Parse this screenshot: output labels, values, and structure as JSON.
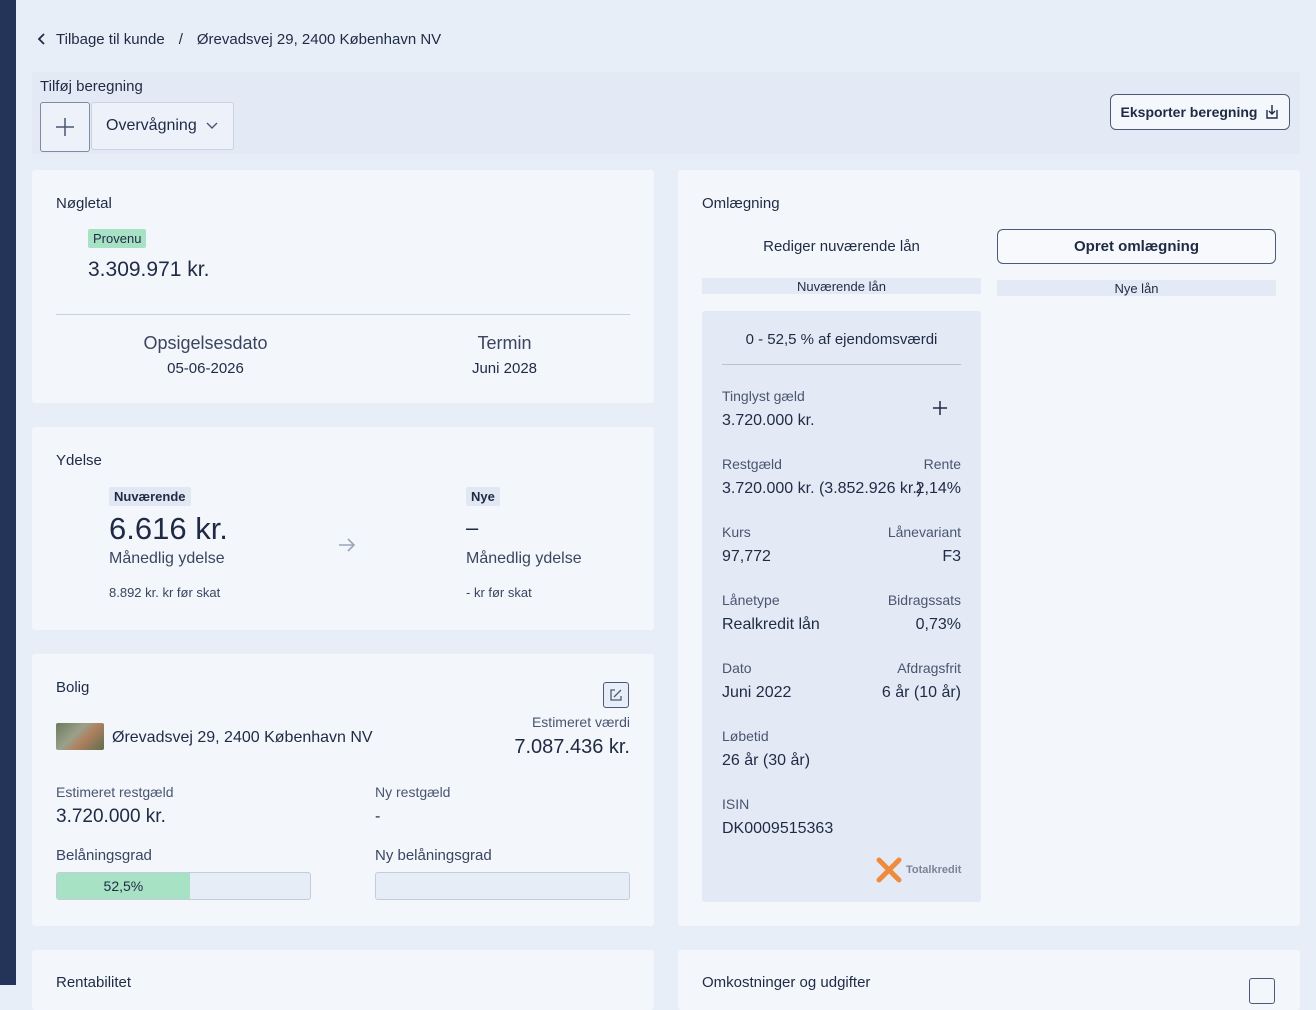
{
  "breadcrumb": {
    "back": "Tilbage til kunde",
    "separator": "/",
    "current": "Ørevadsvej 29, 2400 København NV"
  },
  "toolbar": {
    "add_label": "Tilføj beregning",
    "select_value": "Overvågning",
    "export_label": "Eksporter beregning"
  },
  "noegletal": {
    "title": "Nøgletal",
    "badge": "Provenu",
    "amount": "3.309.971 kr.",
    "opsigelse_label": "Opsigelsesdato",
    "opsigelse_value": "05-06-2026",
    "termin_label": "Termin",
    "termin_value": "Juni 2028"
  },
  "ydelse": {
    "title": "Ydelse",
    "current_badge": "Nuværende",
    "current_value": "6.616 kr.",
    "current_sub": "Månedlig ydelse",
    "current_tax": "8.892 kr. kr før skat",
    "new_badge": "Nye",
    "new_value": "–",
    "new_sub": "Månedlig ydelse",
    "new_tax": "- kr før skat"
  },
  "bolig": {
    "title": "Bolig",
    "address": "Ørevadsvej 29, 2400 København NV",
    "est_value_label": "Estimeret værdi",
    "est_value": "7.087.436 kr.",
    "est_rest_label": "Estimeret restgæld",
    "est_rest": "3.720.000 kr.",
    "new_rest_label": "Ny restgæld",
    "new_rest": "-",
    "ltv_label": "Belåningsgrad",
    "ltv_value": "52,5%",
    "ltv_fraction": 0.525,
    "new_ltv_label": "Ny belåningsgrad"
  },
  "omlaegning": {
    "title": "Omlægning",
    "edit_label": "Rediger nuværende lån",
    "create_label": "Opret omlægning",
    "current_tab": "Nuværende lån",
    "new_tab": "Nye lån",
    "loan": {
      "range": "0 - 52,5 % af ejendomsværdi",
      "tinglyst_label": "Tinglyst gæld",
      "tinglyst_value": "3.720.000 kr.",
      "restgaeld_label": "Restgæld",
      "restgaeld_value": "3.720.000 kr. (3.852.926 kr.)",
      "rente_label": "Rente",
      "rente_value": "2,14%",
      "kurs_label": "Kurs",
      "kurs_value": "97,772",
      "variant_label": "Lånevariant",
      "variant_value": "F3",
      "type_label": "Lånetype",
      "type_value": "Realkredit lån",
      "bidrag_label": "Bidragssats",
      "bidrag_value": "0,73%",
      "dato_label": "Dato",
      "dato_value": "Juni 2022",
      "afdrag_label": "Afdragsfrit",
      "afdrag_value": "6 år (10 år)",
      "loebetid_label": "Løbetid",
      "loebetid_value": "26 år (30 år)",
      "isin_label": "ISIN",
      "isin_value": "DK0009515363",
      "lender": "Totalkredit"
    }
  },
  "bottom": {
    "left_title": "Rentabilitet",
    "right_title": "Omkostninger og udgifter"
  },
  "colors": {
    "accent_green": "#a7e2c5",
    "sidebar": "#233458",
    "card": "#f3f6fb",
    "page": "#e8eef7",
    "totalkredit_orange": "#f08a3c"
  }
}
